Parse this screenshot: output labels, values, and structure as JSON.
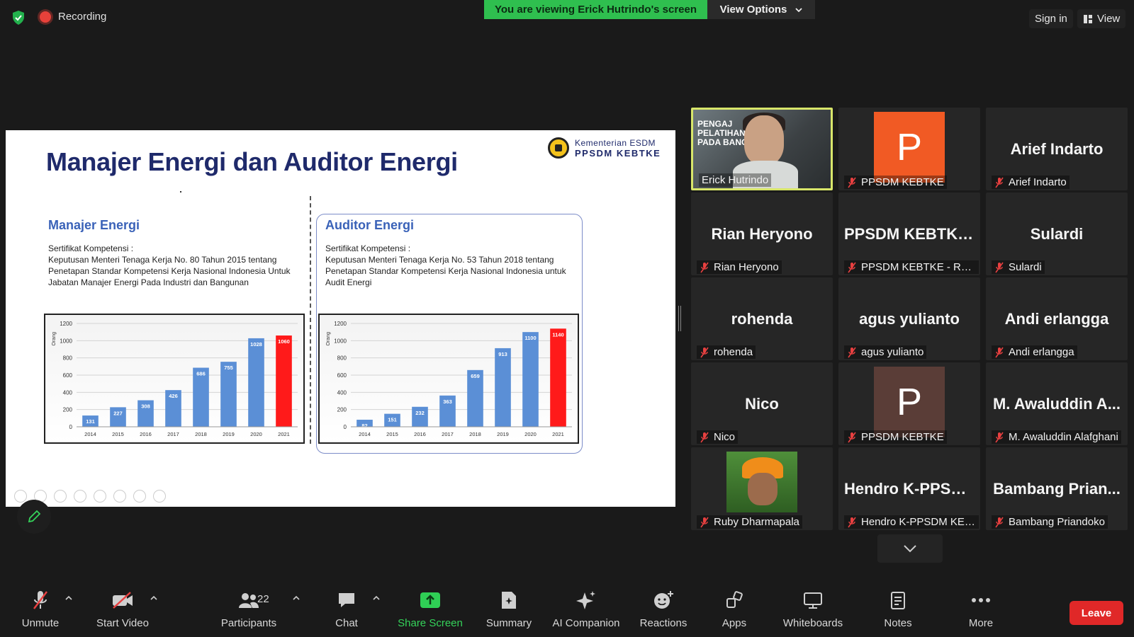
{
  "top_bar": {
    "recording_label": "Recording",
    "viewing_banner": "You are viewing Erick Hutrindo's screen",
    "view_options_label": "View Options",
    "sign_in_label": "Sign in",
    "view_label": "View"
  },
  "slide": {
    "title": "Manajer Energi dan Auditor Energi",
    "logo_line1": "Kementerian ESDM",
    "logo_line2": "PPSDM KEBTKE",
    "left": {
      "heading": "Manajer Energi",
      "text": "Sertifikat Kompetensi :\nKeputusan Menteri Tenaga Kerja No. 80 Tahun 2015 tentang Penetapan Standar Kompetensi Kerja Nasional Indonesia Untuk Jabatan Manajer Energi Pada Industri dan Bangunan"
    },
    "right": {
      "heading": "Auditor Energi",
      "text": "Sertifikat Kompetensi :\nKeputusan Menteri Tenaga Kerja No. 53 Tahun 2018 tentang Penetapan Standar Kompetensi Kerja Nasional Indonesia untuk Audit Energi"
    }
  },
  "chart_data": [
    {
      "type": "bar",
      "ylabel": "Orang",
      "ylim": [
        0,
        1200
      ],
      "yticks": [
        "0",
        "200",
        "400",
        "600",
        "800",
        "1000",
        "1200"
      ],
      "categories": [
        "2014",
        "2015",
        "2016",
        "2017",
        "2018",
        "2019",
        "2020",
        "2021"
      ],
      "values": [
        131,
        227,
        308,
        426,
        686,
        755,
        1028,
        1060
      ],
      "colors": [
        "#5b8fd6",
        "#5b8fd6",
        "#5b8fd6",
        "#5b8fd6",
        "#5b8fd6",
        "#5b8fd6",
        "#5b8fd6",
        "#ff1a1a"
      ],
      "grid": true
    },
    {
      "type": "bar",
      "ylabel": "Orang",
      "ylim": [
        0,
        1200
      ],
      "yticks": [
        "0",
        "200",
        "400",
        "600",
        "800",
        "1000",
        "1200"
      ],
      "categories": [
        "2014",
        "2015",
        "2016",
        "2017",
        "2018",
        "2019",
        "2020",
        "2021"
      ],
      "values": [
        82,
        151,
        232,
        363,
        659,
        913,
        1100,
        1140
      ],
      "colors": [
        "#5b8fd6",
        "#5b8fd6",
        "#5b8fd6",
        "#5b8fd6",
        "#5b8fd6",
        "#5b8fd6",
        "#5b8fd6",
        "#ff1a1a"
      ],
      "grid": true
    }
  ],
  "gallery": {
    "tiles": [
      {
        "center": "",
        "name": "Erick Hutrindo",
        "muted": false,
        "kind": "video-erick",
        "active": true
      },
      {
        "center": "",
        "name": "PPSDM KEBTKE",
        "muted": true,
        "kind": "avatar-p-orange"
      },
      {
        "center": "Arief Indarto",
        "name": "Arief Indarto",
        "muted": true,
        "kind": "name"
      },
      {
        "center": "Rian Heryono",
        "name": "Rian Heryono",
        "muted": true,
        "kind": "name"
      },
      {
        "center": "PPSDM  KEBTKE...",
        "name": "PPSDM KEBTKE - Rade...",
        "muted": true,
        "kind": "name"
      },
      {
        "center": "Sulardi",
        "name": "Sulardi",
        "muted": true,
        "kind": "name"
      },
      {
        "center": "rohenda",
        "name": "rohenda",
        "muted": true,
        "kind": "name"
      },
      {
        "center": "agus yulianto",
        "name": "agus yulianto",
        "muted": true,
        "kind": "name"
      },
      {
        "center": "Andi erlangga",
        "name": "Andi erlangga",
        "muted": true,
        "kind": "name"
      },
      {
        "center": "Nico",
        "name": "Nico",
        "muted": true,
        "kind": "name"
      },
      {
        "center": "",
        "name": "PPSDM KEBTKE",
        "muted": true,
        "kind": "avatar-p-brown"
      },
      {
        "center": "M. Awaluddin A...",
        "name": "M. Awaluddin Alafghani",
        "muted": true,
        "kind": "name"
      },
      {
        "center": "",
        "name": "Ruby Dharmapala",
        "muted": true,
        "kind": "photo-ruby"
      },
      {
        "center": "Hendro  K-PPSD...",
        "name": "Hendro K-PPSDM KEB...",
        "muted": true,
        "kind": "name"
      },
      {
        "center": "Bambang  Prian...",
        "name": "Bambang Priandoko",
        "muted": true,
        "kind": "name"
      }
    ],
    "avatar_letter": "P",
    "avatar_colors": {
      "orange": "#f15a24",
      "brown": "#5a3d37"
    },
    "erick_banner": "PENGAJ\nPELATIHAN T\nPADA BANGU"
  },
  "toolbar": {
    "unmute": "Unmute",
    "start_video": "Start Video",
    "participants": "Participants",
    "participants_count": "22",
    "chat": "Chat",
    "share_screen": "Share Screen",
    "summary": "Summary",
    "ai_companion": "AI Companion",
    "reactions": "Reactions",
    "apps": "Apps",
    "whiteboards": "Whiteboards",
    "notes": "Notes",
    "more": "More",
    "leave": "Leave"
  },
  "colors": {
    "share_green": "#35d35a",
    "viewing_green": "#2fbf4f",
    "leave_red": "#e02828",
    "active_border": "#d8e66a"
  }
}
